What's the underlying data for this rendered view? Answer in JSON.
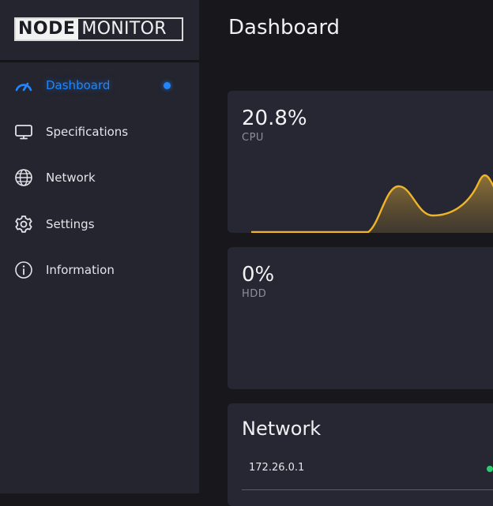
{
  "logo": {
    "part1": "NODE",
    "part2": "MONITOR"
  },
  "sidebar": {
    "items": [
      {
        "label": "Dashboard",
        "icon": "gauge-icon",
        "active": true
      },
      {
        "label": "Specifications",
        "icon": "monitor-icon",
        "active": false
      },
      {
        "label": "Network",
        "icon": "globe-icon",
        "active": false
      },
      {
        "label": "Settings",
        "icon": "gear-icon",
        "active": false
      },
      {
        "label": "Information",
        "icon": "info-icon",
        "active": false
      }
    ]
  },
  "main": {
    "title": "Dashboard",
    "cpu": {
      "value": "20.8%",
      "label": "CPU"
    },
    "hdd": {
      "value": "0%",
      "label": "HDD"
    },
    "network": {
      "title": "Network",
      "entries": [
        {
          "ip": "172.26.0.1",
          "status": "online"
        }
      ]
    }
  },
  "colors": {
    "accent": "#1f86ff",
    "chart_line": "#f0b429",
    "status_online": "#2ecc71"
  }
}
